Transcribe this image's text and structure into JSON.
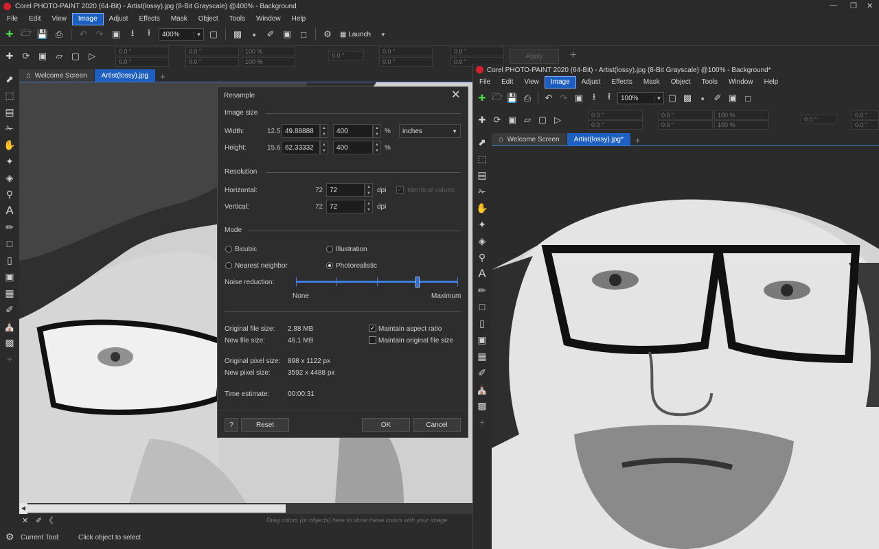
{
  "left_window": {
    "title": "Corel PHOTO-PAINT 2020 (64-Bit) - Artist(lossy).jpg (8-Bit Grayscale) @400% - Background",
    "menu": [
      "File",
      "Edit",
      "View",
      "Image",
      "Adjust",
      "Effects",
      "Mask",
      "Object",
      "Tools",
      "Window",
      "Help"
    ],
    "active_menu": "Image",
    "zoom": "400%",
    "launch_label": "Launch",
    "property_bar": {
      "x1": "0.0 \"",
      "y1": "0.0 \"",
      "x2": "0.0 \"",
      "y2": "0.0 \"",
      "sx": "100 %",
      "sy": "100 %",
      "angle": "0.0 °",
      "cx": "0.0 \"",
      "cy": "0.0 \"",
      "cx2": "0.0 \"",
      "cy2": "0.0 \"",
      "apply": "Apply"
    },
    "tabs": [
      "Welcome Screen",
      "Artist(lossy).jpg"
    ],
    "palette_hint": "Drag colors (or objects) here to store these colors with your image",
    "status_label": "Current Tool:",
    "status_value": "Click object to select"
  },
  "right_window": {
    "title": "Corel PHOTO-PAINT 2020 (64-Bit) - Artist(lossy).jpg (8-Bit Grayscale) @100% - Background*",
    "menu": [
      "File",
      "Edit",
      "View",
      "Image",
      "Adjust",
      "Effects",
      "Mask",
      "Object",
      "Tools",
      "Window",
      "Help"
    ],
    "active_menu": "Image",
    "zoom": "100%",
    "property_bar": {
      "x1": "0.0 \"",
      "y1": "0.0 \"",
      "x2": "0.0 \"",
      "y2": "0.0 \"",
      "sx": "100 %",
      "sy": "100 %",
      "angle": "0.0 °",
      "cx": "0.0 \"",
      "cy": "0.0 \""
    },
    "tabs": [
      "Welcome Screen",
      "Artist(lossy).jpg*"
    ]
  },
  "dialog": {
    "title": "Resample",
    "image_size_header": "Image size",
    "width_label": "Width:",
    "width_orig": "12.5",
    "width_value": "49.88888",
    "width_pct": "400",
    "height_label": "Height:",
    "height_orig": "15.6",
    "height_value": "62.33332",
    "height_pct": "400",
    "pct_symbol": "%",
    "units": "inches",
    "resolution_header": "Resolution",
    "horizontal_label": "Horizontal:",
    "horizontal_orig": "72",
    "horizontal_value": "72",
    "vertical_label": "Vertical:",
    "vertical_orig": "72",
    "vertical_value": "72",
    "dpi": "dpi",
    "identical_values": "Identical values",
    "mode_header": "Mode",
    "mode_bicubic": "Bicubic",
    "mode_illustration": "Illustration",
    "mode_nearest": "Nearest neighbor",
    "mode_photorealistic": "Photorealistic",
    "mode_selected": "Photorealistic",
    "noise_label": "Noise reduction:",
    "noise_min": "None",
    "noise_max": "Maximum",
    "noise_level": 0.75,
    "orig_file_size_label": "Original file size:",
    "orig_file_size": "2.88 MB",
    "new_file_size_label": "New file size:",
    "new_file_size": "46.1 MB",
    "maintain_aspect": "Maintain aspect ratio",
    "maintain_aspect_checked": true,
    "maintain_file_size": "Maintain original file size",
    "maintain_file_size_checked": false,
    "orig_pixel_label": "Original pixel size:",
    "orig_pixel": "898 x 1122 px",
    "new_pixel_label": "New pixel size:",
    "new_pixel": "3592 x 4488 px",
    "time_label": "Time estimate:",
    "time_value": "00:00:31",
    "help_btn": "?",
    "reset_btn": "Reset",
    "ok_btn": "OK",
    "cancel_btn": "Cancel"
  }
}
